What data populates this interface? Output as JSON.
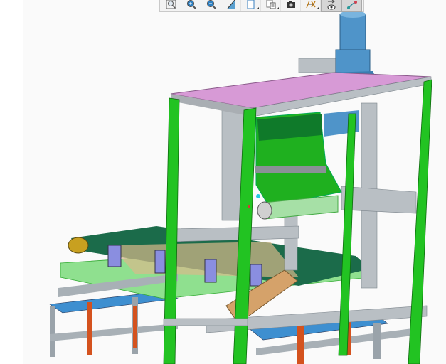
{
  "toolbar": {
    "buttons": [
      {
        "name": "zoom-fit",
        "icon": "zoom-fit-icon",
        "active": false
      },
      {
        "name": "zoom-in",
        "icon": "zoom-in-icon",
        "active": false
      },
      {
        "name": "zoom-out",
        "icon": "zoom-out-icon",
        "active": false
      },
      {
        "name": "repaint",
        "icon": "repaint-icon",
        "active": false
      },
      {
        "name": "display-style",
        "icon": "display-style-icon",
        "active": false
      },
      {
        "name": "saved-views",
        "icon": "saved-views-icon",
        "active": false
      },
      {
        "name": "snapshot",
        "icon": "camera-icon",
        "active": false
      },
      {
        "name": "datum-display",
        "icon": "datum-icon",
        "active": false
      },
      {
        "name": "annotation-display",
        "icon": "annotation-eye-icon",
        "active": true
      },
      {
        "name": "spin-center",
        "icon": "spin-center-icon",
        "active": true
      }
    ]
  },
  "colors": {
    "frame_green": "#22c322",
    "top_plate": "#d79ad6",
    "belt": "#1b6b4a",
    "motor": "#4f94c9",
    "base_blue": "#3e8fd0",
    "aluminum": "#b9bfc4"
  }
}
